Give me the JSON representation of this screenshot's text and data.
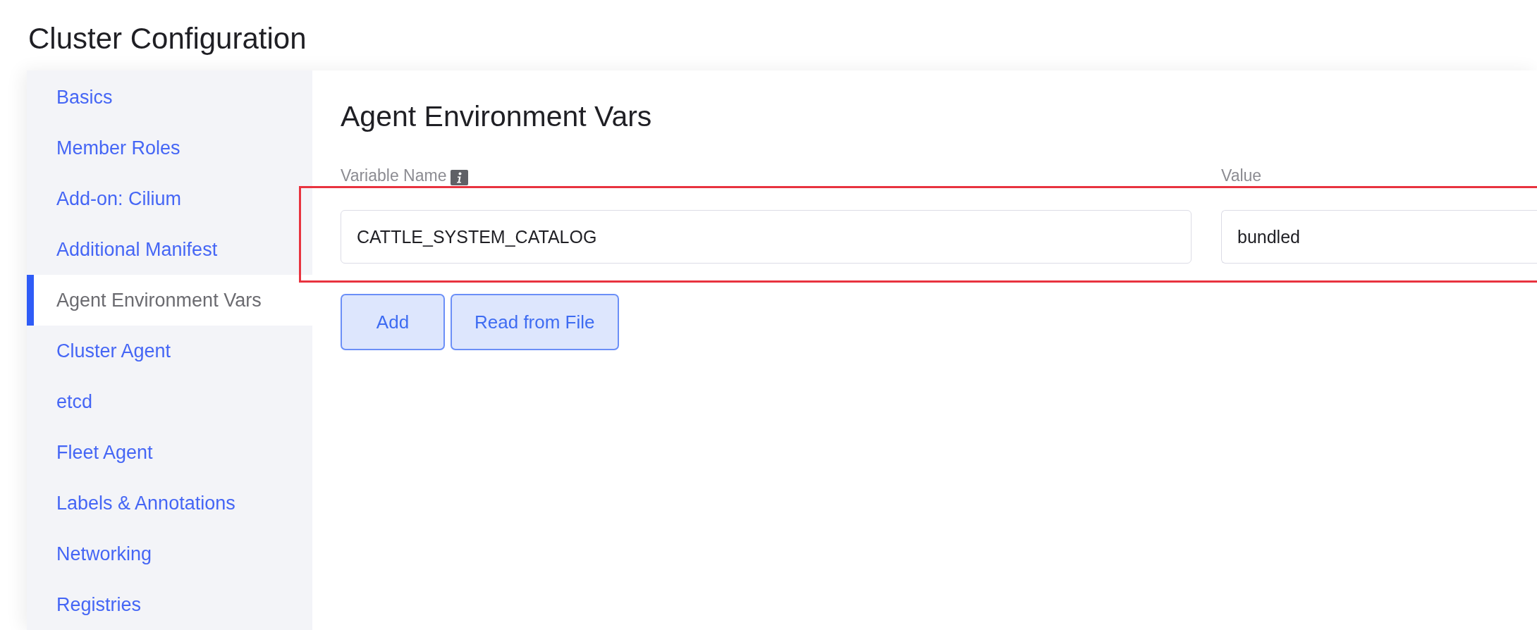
{
  "page": {
    "title": "Cluster Configuration"
  },
  "sidebar": {
    "items": [
      {
        "label": "Basics",
        "selected": false
      },
      {
        "label": "Member Roles",
        "selected": false
      },
      {
        "label": "Add-on: Cilium",
        "selected": false
      },
      {
        "label": "Additional Manifest",
        "selected": false
      },
      {
        "label": "Agent Environment Vars",
        "selected": true
      },
      {
        "label": "Cluster Agent",
        "selected": false
      },
      {
        "label": "etcd",
        "selected": false
      },
      {
        "label": "Fleet Agent",
        "selected": false
      },
      {
        "label": "Labels & Annotations",
        "selected": false
      },
      {
        "label": "Networking",
        "selected": false
      },
      {
        "label": "Registries",
        "selected": false
      }
    ]
  },
  "section": {
    "title": "Agent Environment Vars",
    "columns": [
      {
        "label": "Variable Name",
        "info": true
      },
      {
        "label": "Value",
        "info": false
      }
    ],
    "rows": [
      {
        "name": "CATTLE_SYSTEM_CATALOG",
        "value": "bundled",
        "highlighted": true
      }
    ],
    "buttons": [
      {
        "label": "Add"
      },
      {
        "label": "Read from File"
      }
    ]
  }
}
